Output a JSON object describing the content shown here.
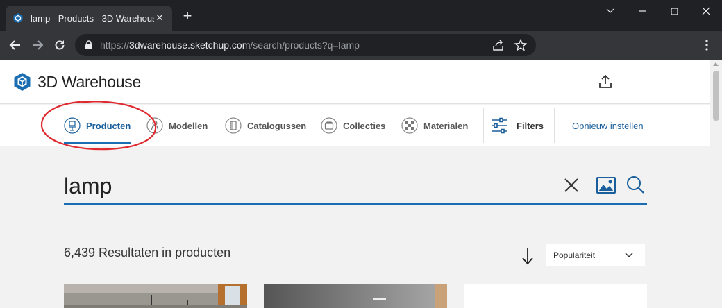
{
  "browser": {
    "tab_title": "lamp - Products - 3D Warehouse",
    "url_scheme": "https://",
    "url_host": "3dwarehouse.sketchup.com",
    "url_path": "/search/products?q=lamp"
  },
  "header": {
    "brand": "3D Warehouse"
  },
  "content_types": [
    {
      "label": "Producten",
      "icon": "chair-icon",
      "active": true
    },
    {
      "label": "Modellen",
      "icon": "person-icon",
      "active": false
    },
    {
      "label": "Catalogussen",
      "icon": "catalog-icon",
      "active": false
    },
    {
      "label": "Collecties",
      "icon": "collection-icon",
      "active": false
    },
    {
      "label": "Materialen",
      "icon": "material-icon",
      "active": false
    }
  ],
  "filters_label": "Filters",
  "reset_label": "Opnieuw instellen",
  "search": {
    "query": "lamp"
  },
  "results": {
    "summary": "6,439 Resultaten in producten",
    "sort_selected": "Populariteit"
  },
  "colors": {
    "accent": "#1a6db0",
    "annotation": "#e0292e"
  }
}
